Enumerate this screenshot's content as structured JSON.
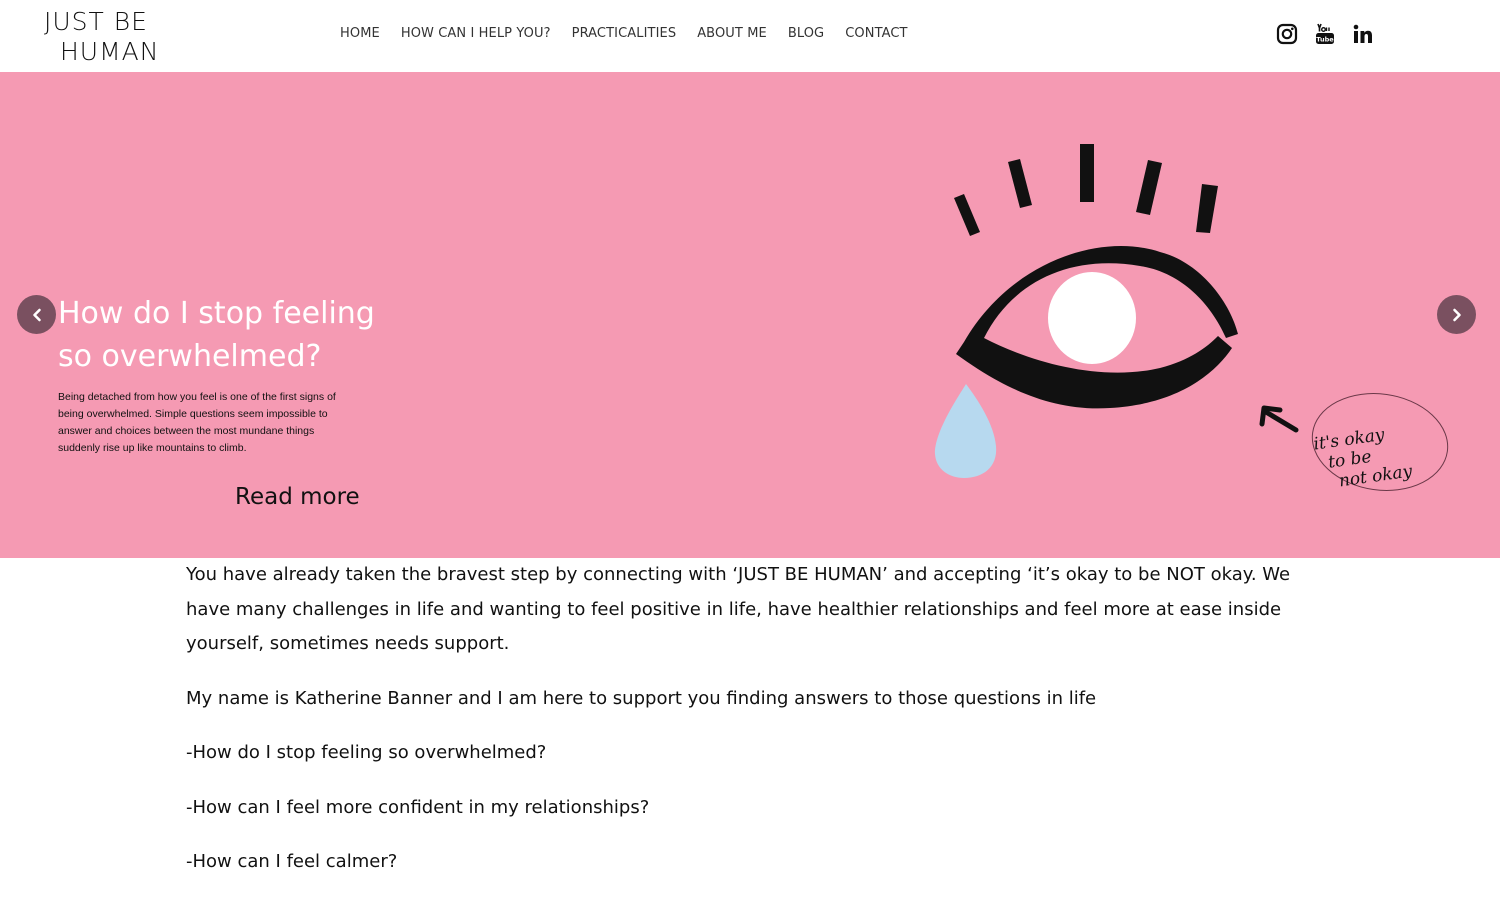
{
  "header": {
    "logo_line1": "JUST BE",
    "logo_line2": "HUMAN",
    "nav": [
      {
        "label": "HOME"
      },
      {
        "label": "HOW CAN I HELP YOU?"
      },
      {
        "label": "PRACTICALITIES"
      },
      {
        "label": "ABOUT ME"
      },
      {
        "label": "BLOG"
      },
      {
        "label": "CONTACT"
      }
    ],
    "social": [
      {
        "icon": "instagram-icon"
      },
      {
        "icon": "youtube-icon"
      },
      {
        "icon": "linkedin-icon"
      }
    ]
  },
  "hero": {
    "background": "#f59ab3",
    "title": "How do I stop feeling so overwhelmed?",
    "description": "Being detached from how you feel is one of the first signs of being overwhelmed. Simple questions seem impossible to answer and choices between the most mundane things suddenly rise up like mountains to climb.",
    "read_more": "Read more",
    "note_line1": "it's okay",
    "note_line2": "to be",
    "note_line3": "not okay"
  },
  "content": {
    "paragraph1": "You have already taken the bravest step by connecting with ‘JUST BE HUMAN’ and accepting ‘it’s okay to be NOT okay. We have many challenges in life and wanting to feel positive in life, have healthier relationships and feel more at ease inside yourself, sometimes needs support.",
    "paragraph2": "My name is Katherine Banner and I am here to support you finding answers to those questions in life",
    "questions": [
      "-How do I stop feeling so overwhelmed?",
      "-How can I feel more confident in my relationships?",
      "-How can I feel calmer?"
    ]
  }
}
